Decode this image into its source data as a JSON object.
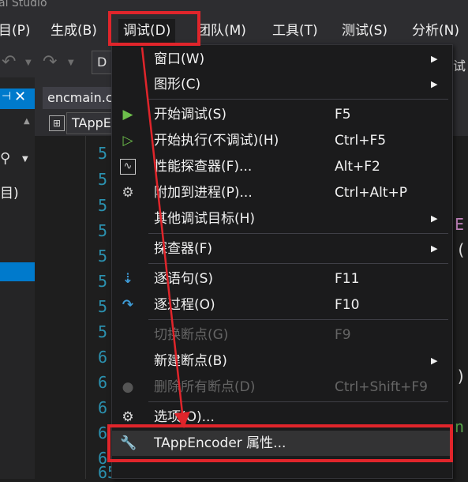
{
  "window": {
    "title_fragment": "al Studio"
  },
  "menubar": {
    "items": [
      {
        "label": "目(P)"
      },
      {
        "label": "生成(B)"
      },
      {
        "label": "调试(D)"
      },
      {
        "label": "团队(M)"
      },
      {
        "label": "工具(T)"
      },
      {
        "label": "测试(S)"
      },
      {
        "label": "分析(N)"
      }
    ]
  },
  "toolbar": {
    "combo_value": "D",
    "right_text": "试"
  },
  "left_panel": {
    "tab_label": "目)"
  },
  "editor": {
    "tab_label": "encmain.c",
    "nav_label": "TAppE",
    "line_numbers": [
      "5",
      "5",
      "5",
      "5",
      "5",
      "5",
      "5",
      "5",
      "6",
      "6",
      "6",
      "6",
      "6",
      "6",
      "65"
    ],
    "code_fragments": [
      "E",
      "(",
      ")",
      "n"
    ]
  },
  "debug_menu": {
    "items": [
      {
        "label": "窗口(W)",
        "shortcut": "",
        "submenu": true,
        "disabled": false,
        "icon": ""
      },
      {
        "label": "图形(C)",
        "shortcut": "",
        "submenu": true,
        "disabled": false,
        "icon": ""
      },
      {
        "label": "开始调试(S)",
        "shortcut": "F5",
        "submenu": false,
        "disabled": false,
        "icon": "play-icon"
      },
      {
        "label": "开始执行(不调试)(H)",
        "shortcut": "Ctrl+F5",
        "submenu": false,
        "disabled": false,
        "icon": "play-outline-icon"
      },
      {
        "label": "性能探查器(F)...",
        "shortcut": "Alt+F2",
        "submenu": false,
        "disabled": false,
        "icon": "performance-icon"
      },
      {
        "label": "附加到进程(P)...",
        "shortcut": "Ctrl+Alt+P",
        "submenu": false,
        "disabled": false,
        "icon": "attach-process-icon"
      },
      {
        "label": "其他调试目标(H)",
        "shortcut": "",
        "submenu": true,
        "disabled": false,
        "icon": ""
      },
      {
        "label": "探查器(F)",
        "shortcut": "",
        "submenu": true,
        "disabled": false,
        "icon": ""
      },
      {
        "label": "逐语句(S)",
        "shortcut": "F11",
        "submenu": false,
        "disabled": false,
        "icon": "step-into-icon"
      },
      {
        "label": "逐过程(O)",
        "shortcut": "F10",
        "submenu": false,
        "disabled": false,
        "icon": "step-over-icon"
      },
      {
        "label": "切换断点(G)",
        "shortcut": "F9",
        "submenu": false,
        "disabled": true,
        "icon": ""
      },
      {
        "label": "新建断点(B)",
        "shortcut": "",
        "submenu": true,
        "disabled": false,
        "icon": ""
      },
      {
        "label": "删除所有断点(D)",
        "shortcut": "Ctrl+Shift+F9",
        "submenu": false,
        "disabled": true,
        "icon": "delete-breakpoints-icon"
      },
      {
        "label": "选项(O)...",
        "shortcut": "",
        "submenu": false,
        "disabled": false,
        "icon": "gear-icon"
      },
      {
        "label": "TAppEncoder 属性...",
        "shortcut": "",
        "submenu": false,
        "disabled": false,
        "icon": "wrench-icon"
      }
    ]
  },
  "colors": {
    "annotation_red": "#e0252b",
    "accent_blue": "#007acc",
    "play_green": "#6dbf4b"
  }
}
